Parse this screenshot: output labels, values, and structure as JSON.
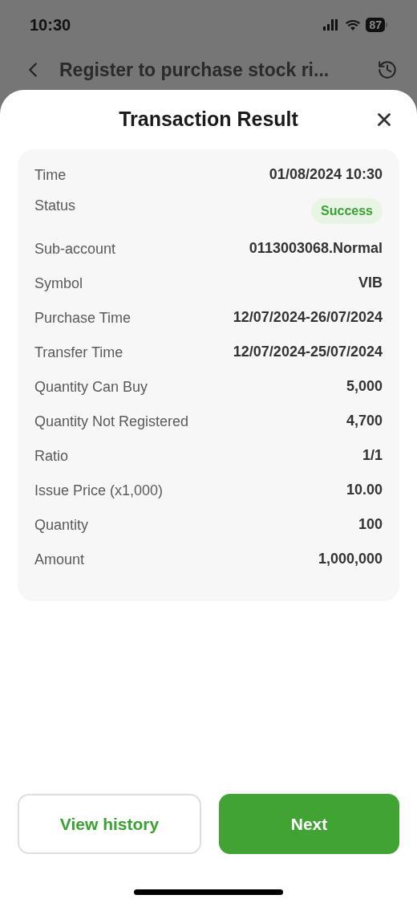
{
  "status_bar": {
    "time": "10:30",
    "battery": "87"
  },
  "header": {
    "title": "Register to purchase stock ri..."
  },
  "sheet": {
    "title": "Transaction Result",
    "rows": [
      {
        "label": "Time",
        "value": "01/08/2024 10:30",
        "kind": "text"
      },
      {
        "label": "Status",
        "value": "Success",
        "kind": "badge"
      },
      {
        "label": "Sub-account",
        "value": "0113003068.Normal",
        "kind": "text"
      },
      {
        "label": "Symbol",
        "value": "VIB",
        "kind": "text"
      },
      {
        "label": "Purchase Time",
        "value": "12/07/2024-26/07/2024",
        "kind": "text"
      },
      {
        "label": "Transfer Time",
        "value": "12/07/2024-25/07/2024",
        "kind": "text"
      },
      {
        "label": "Quantity Can Buy",
        "value": "5,000",
        "kind": "text"
      },
      {
        "label": "Quantity Not Registered",
        "value": "4,700",
        "kind": "text"
      },
      {
        "label": "Ratio",
        "value": "1/1",
        "kind": "text"
      },
      {
        "label": "Issue Price (x1,000)",
        "value": "10.00",
        "kind": "text"
      },
      {
        "label": "Quantity",
        "value": "100",
        "kind": "text"
      },
      {
        "label": "Amount",
        "value": "1,000,000",
        "kind": "text"
      }
    ]
  },
  "buttons": [
    {
      "label": "View history",
      "kind": "secondary"
    },
    {
      "label": "Next",
      "kind": "primary"
    }
  ]
}
